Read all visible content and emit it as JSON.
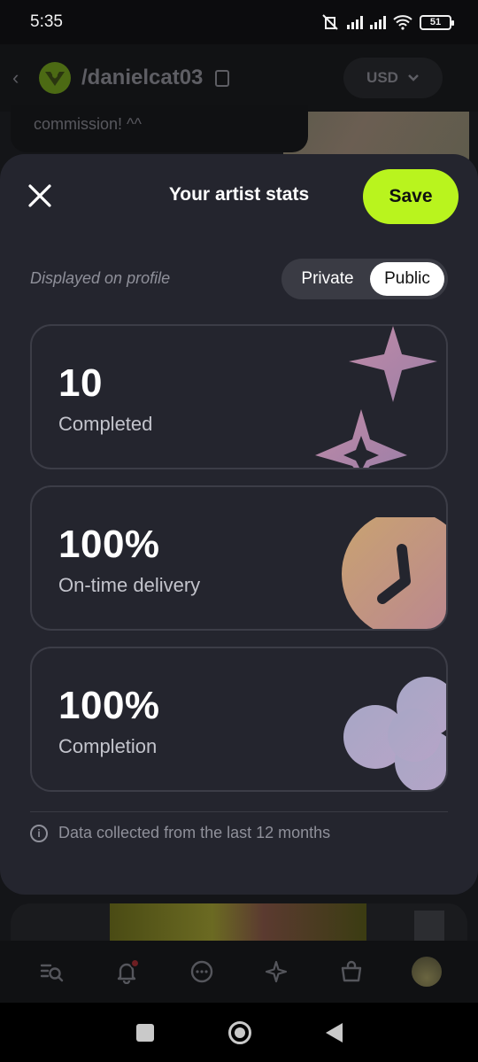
{
  "status_bar": {
    "time": "5:35",
    "battery": "51"
  },
  "background": {
    "username": "/danielcat03",
    "currency": "USD",
    "message_snippet": "commission! ^^"
  },
  "sheet": {
    "title": "Your artist stats",
    "save_label": "Save",
    "display_label": "Displayed on profile",
    "visibility": {
      "options": [
        "Private",
        "Public"
      ],
      "selected": "Public"
    },
    "stats": [
      {
        "value": "10",
        "label": "Completed",
        "icon": "sparkle-stars-icon"
      },
      {
        "value": "100%",
        "label": "On-time delivery",
        "icon": "clock-icon"
      },
      {
        "value": "100%",
        "label": "Completion",
        "icon": "flower-icon"
      }
    ],
    "footnote": "Data collected from the last 12 months"
  },
  "bottom_nav": [
    "search-list-icon",
    "bell-icon",
    "chat-icon",
    "sparkle-icon",
    "shop-bag-icon",
    "avatar"
  ],
  "colors": {
    "accent": "#b9f41e",
    "sheet_bg": "#24252e",
    "card_border": "#3c3d47"
  }
}
